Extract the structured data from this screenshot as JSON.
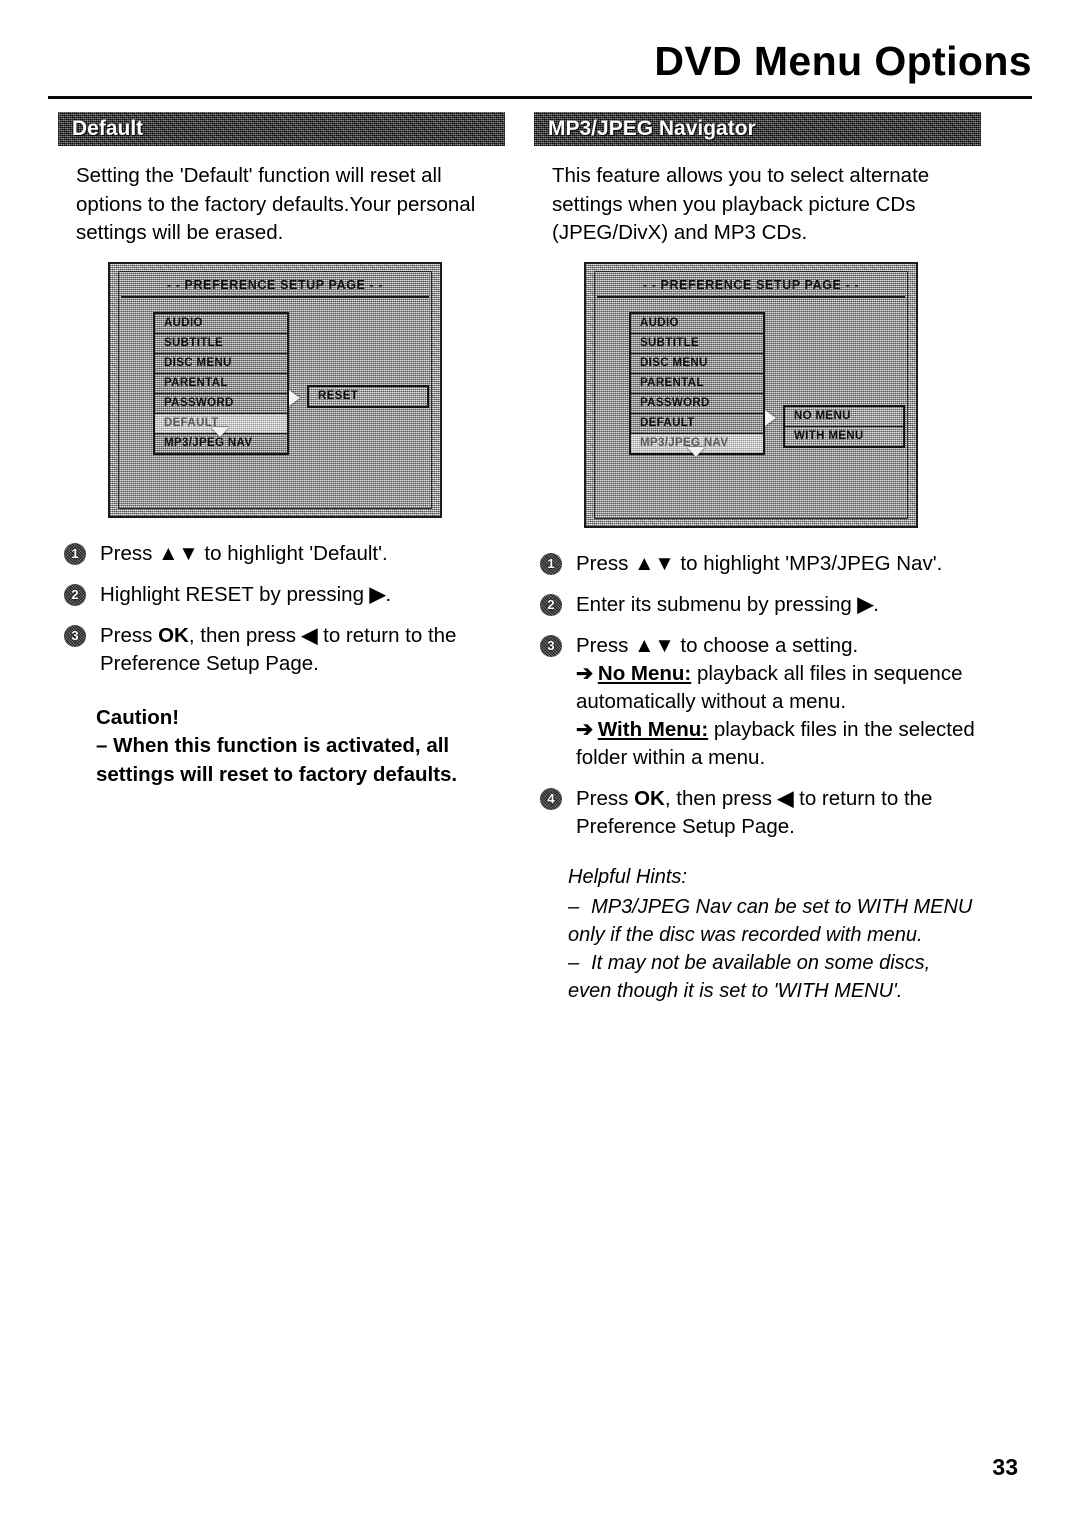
{
  "header": {
    "title": "DVD Menu Options"
  },
  "page_number": "33",
  "left_column": {
    "section_title": "Default",
    "intro": "Setting the 'Default' function will reset all options to the factory defaults.Your personal settings will be erased.",
    "screen": {
      "title": "- - PREFERENCE SETUP PAGE - -",
      "menu_items": [
        {
          "label": "AUDIO",
          "selected": false
        },
        {
          "label": "SUBTITLE",
          "selected": false
        },
        {
          "label": "DISC MENU",
          "selected": false
        },
        {
          "label": "PARENTAL",
          "selected": false
        },
        {
          "label": "PASSWORD",
          "selected": false
        },
        {
          "label": "DEFAULT",
          "selected": true
        },
        {
          "label": "MP3/JPEG NAV",
          "selected": false
        }
      ],
      "submenu_items": [
        {
          "label": "RESET"
        }
      ]
    },
    "steps": [
      {
        "number": "1",
        "text_html": "Press <b>&#9650;&#9660;</b> to highlight 'Default'."
      },
      {
        "number": "2",
        "text_html": "Highlight RESET by pressing <b>&#9654;</b>."
      },
      {
        "number": "3",
        "text_html": "Press <b>OK</b>, then press <b>&#9664;</b> to return to the Preference Setup Page."
      }
    ],
    "caution": {
      "heading": "Caution!",
      "body": "–  When this function is activated, all settings will reset to factory defaults."
    }
  },
  "right_column": {
    "section_title": "MP3/JPEG Navigator",
    "intro": "This feature allows you to select alternate settings when you playback picture CDs (JPEG/DivX) and MP3 CDs.",
    "screen": {
      "title": "- - PREFERENCE SETUP PAGE - -",
      "menu_items": [
        {
          "label": "AUDIO",
          "selected": false
        },
        {
          "label": "SUBTITLE",
          "selected": false
        },
        {
          "label": "DISC MENU",
          "selected": false
        },
        {
          "label": "PARENTAL",
          "selected": false
        },
        {
          "label": "PASSWORD",
          "selected": false
        },
        {
          "label": "DEFAULT",
          "selected": false
        },
        {
          "label": "MP3/JPEG NAV",
          "selected": true
        }
      ],
      "submenu_items": [
        {
          "label": "NO MENU"
        },
        {
          "label": "WITH MENU"
        }
      ]
    },
    "steps": [
      {
        "number": "1",
        "text_html": "Press <b>&#9650;&#9660;</b> to highlight 'MP3/JPEG Nav'."
      },
      {
        "number": "2",
        "text_html": "Enter its submenu by pressing <b>&#9654;</b>."
      },
      {
        "number": "3",
        "text_html": "Press <b>&#9650;&#9660;</b> to choose a setting."
      },
      {
        "number": "4",
        "text_html": "Press <b>OK</b>, then press <b>&#9664;</b> to return to the Preference Setup Page."
      }
    ],
    "option_descriptions": [
      {
        "arrow": "➔",
        "term": "No Menu:",
        "text": " playback all files in sequence automatically without a menu."
      },
      {
        "arrow": "➔",
        "term": "With Menu:",
        "text": " playback files in the selected folder within a menu."
      }
    ],
    "helpful_hints": {
      "heading": "Helpful Hints:",
      "items": [
        "MP3/JPEG Nav can be set to WITH MENU only if the disc was recorded with menu.",
        "It may not be available on some discs, even though it is set to 'WITH MENU'."
      ],
      "dash": "–"
    }
  }
}
